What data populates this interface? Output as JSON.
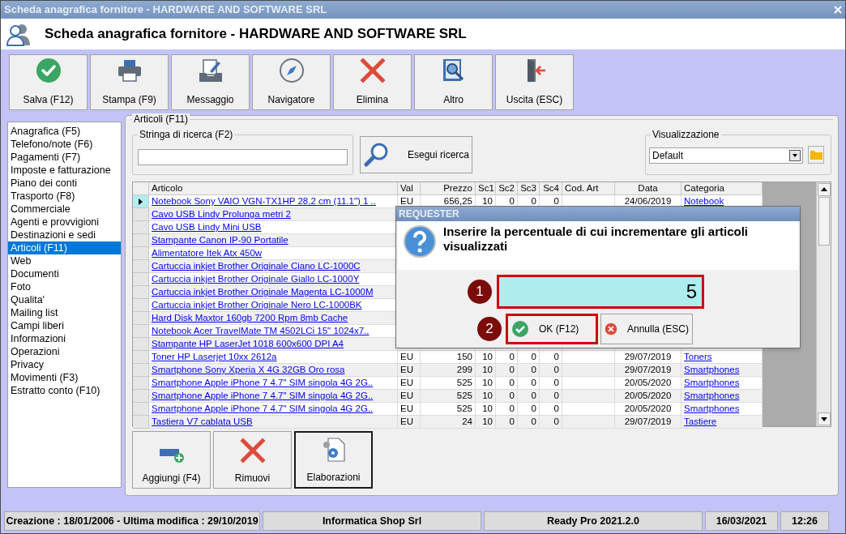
{
  "window": {
    "title": "Scheda anagrafica fornitore - HARDWARE AND SOFTWARE SRL"
  },
  "header": {
    "title": "Scheda anagrafica fornitore - HARDWARE AND SOFTWARE SRL"
  },
  "toolbar": [
    {
      "label": "Salva (F12)",
      "kind": "save"
    },
    {
      "label": "Stampa (F9)",
      "kind": "print"
    },
    {
      "label": "Messaggio",
      "kind": "message"
    },
    {
      "label": "Navigatore",
      "kind": "navigator"
    },
    {
      "label": "Elimina",
      "kind": "delete"
    },
    {
      "label": "Altro",
      "kind": "other"
    },
    {
      "label": "Uscita (ESC)",
      "kind": "exit"
    }
  ],
  "sidebar": {
    "items": [
      {
        "label": "Anagrafica (F5)",
        "selected": false
      },
      {
        "label": "Telefono/note (F6)",
        "selected": false
      },
      {
        "label": "Pagamenti (F7)",
        "selected": false
      },
      {
        "label": "Imposte e fatturazione",
        "selected": false
      },
      {
        "label": "Piano dei conti",
        "selected": false
      },
      {
        "label": "Trasporto (F8)",
        "selected": false
      },
      {
        "label": "Commerciale",
        "selected": false
      },
      {
        "label": "Agenti e provvigioni",
        "selected": false
      },
      {
        "label": "Destinazioni e sedi",
        "selected": false
      },
      {
        "label": "Articoli (F11)",
        "selected": true
      },
      {
        "label": "Web",
        "selected": false
      },
      {
        "label": "Documenti",
        "selected": false
      },
      {
        "label": "Foto",
        "selected": false
      },
      {
        "label": "Qualita'",
        "selected": false
      },
      {
        "label": "Mailing list",
        "selected": false
      },
      {
        "label": "Campi liberi",
        "selected": false
      },
      {
        "label": "Informazioni",
        "selected": false
      },
      {
        "label": "Operazioni",
        "selected": false
      },
      {
        "label": "Privacy",
        "selected": false
      },
      {
        "label": "Movimenti (F3)",
        "selected": false
      },
      {
        "label": "Estratto conto (F10)",
        "selected": false
      }
    ]
  },
  "panel": {
    "title": "Articoli (F11)",
    "search": {
      "label": "Stringa di ricerca (F2)",
      "button": "Esegui ricerca"
    },
    "view": {
      "label": "Visualizzazione",
      "value": "Default"
    }
  },
  "table": {
    "columns": [
      "Articolo",
      "Val",
      "Prezzo",
      "Sc1",
      "Sc2",
      "Sc3",
      "Sc4",
      "Cod. Art",
      "Data",
      "Categoria"
    ],
    "rows": [
      {
        "selected": true,
        "articolo": "Notebook Sony VAIO VGN-TX1HP 28,2 cm (11.1\") 1 ..",
        "val": "EU",
        "prezzo": "656,25",
        "sc1": "10",
        "sc2": "0",
        "sc3": "0",
        "sc4": "0",
        "data": "24/06/2019",
        "categoria": "Notebook"
      },
      {
        "selected": false,
        "articolo": "Cavo USB Lindy Prolunga metri 2"
      },
      {
        "selected": false,
        "articolo": "Cavo USB Lindy Mini USB"
      },
      {
        "selected": false,
        "articolo": "Stampante Canon IP-90 Portatile"
      },
      {
        "selected": false,
        "articolo": "Alimentatore Itek Atx 450w"
      },
      {
        "selected": false,
        "articolo": "Cartuccia inkjet Brother Originale Ciano LC-1000C"
      },
      {
        "selected": false,
        "articolo": "Cartuccia inkjet Brother Originale Giallo LC-1000Y"
      },
      {
        "selected": false,
        "articolo": "Cartuccia inkjet Brother Originale Magenta LC-1000M"
      },
      {
        "selected": false,
        "articolo": "Cartuccia inkjet Brother Originale Nero LC-1000BK"
      },
      {
        "selected": false,
        "articolo": "Hard Disk Maxtor 160gb 7200 Rpm 8mb Cache"
      },
      {
        "selected": false,
        "articolo": "Notebook Acer TravelMate TM 4502LCi 15\" 1024x7.."
      },
      {
        "selected": false,
        "articolo": "Stampante HP LaserJet 1018 600x600 DPI A4"
      },
      {
        "selected": false,
        "articolo": "Toner HP Laserjet 10xx 2612a",
        "val": "EU",
        "prezzo": "150",
        "sc1": "10",
        "sc2": "0",
        "sc3": "0",
        "sc4": "0",
        "data": "29/07/2019",
        "categoria": "Toners"
      },
      {
        "selected": false,
        "articolo": "Smartphone Sony Xperia X 4G 32GB Oro rosa",
        "val": "EU",
        "prezzo": "299",
        "sc1": "10",
        "sc2": "0",
        "sc3": "0",
        "sc4": "0",
        "data": "29/07/2019",
        "categoria": "Smartphones"
      },
      {
        "selected": false,
        "articolo": "Smartphone Apple iPhone 7 4.7\" SIM singola 4G 2G..",
        "val": "EU",
        "prezzo": "525",
        "sc1": "10",
        "sc2": "0",
        "sc3": "0",
        "sc4": "0",
        "data": "20/05/2020",
        "categoria": "Smartphones"
      },
      {
        "selected": false,
        "articolo": "Smartphone Apple iPhone 7 4.7\" SIM singola 4G 2G..",
        "val": "EU",
        "prezzo": "525",
        "sc1": "10",
        "sc2": "0",
        "sc3": "0",
        "sc4": "0",
        "data": "20/05/2020",
        "categoria": "Smartphones"
      },
      {
        "selected": false,
        "articolo": "Smartphone Apple iPhone 7 4.7\" SIM singola 4G 2G..",
        "val": "EU",
        "prezzo": "525",
        "sc1": "10",
        "sc2": "0",
        "sc3": "0",
        "sc4": "0",
        "data": "20/05/2020",
        "categoria": "Smartphones"
      },
      {
        "selected": false,
        "articolo": "Tastiera V7 cablata USB",
        "val": "EU",
        "prezzo": "24",
        "sc1": "10",
        "sc2": "0",
        "sc3": "0",
        "sc4": "0",
        "data": "29/07/2019",
        "categoria": "Tastiere"
      }
    ]
  },
  "actions": [
    {
      "label": "Aggiungi (F4)",
      "kind": "add",
      "focused": false
    },
    {
      "label": "Rimuovi",
      "kind": "remove",
      "focused": false
    },
    {
      "label": "Elaborazioni",
      "kind": "process",
      "focused": true
    }
  ],
  "dialog": {
    "title": "REQUESTER",
    "message": "Inserire la percentuale di cui incrementare gli articoli visualizzati",
    "value": "5",
    "buttons": [
      {
        "label": "OK (F12)",
        "kind": "ok",
        "highlighted": true
      },
      {
        "label": "Annulla (ESC)",
        "kind": "cancel",
        "highlighted": false
      }
    ],
    "markers": [
      "1",
      "2"
    ]
  },
  "status_bar": [
    "Creazione : 18/01/2006 - Ultima modifica : 29/10/2019",
    "Informatica Shop Srl",
    "Ready Pro 2021.2.0",
    "16/03/2021",
    "12:26"
  ]
}
